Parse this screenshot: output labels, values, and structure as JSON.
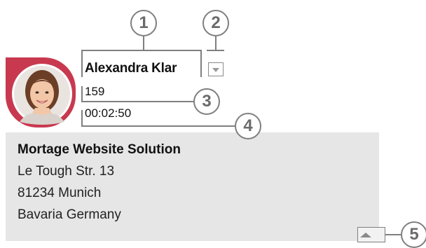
{
  "callouts": [
    "1",
    "2",
    "3",
    "4",
    "5"
  ],
  "contact": {
    "name": "Alexandra Klar",
    "extension": "159",
    "call_timer": "00:02:50"
  },
  "details": {
    "company": "Mortage Website Solution",
    "street": "Le Tough Str. 13",
    "city": "81234 Munich",
    "region": "Bavaria Germany"
  },
  "colors": {
    "avatar_ring": "#c8394f",
    "card_background": "#e6e6e6",
    "callout_gray": "#7f7f7f"
  },
  "icons": {
    "dropdown": "chevron-down-icon",
    "collapse": "chevron-up-icon"
  }
}
